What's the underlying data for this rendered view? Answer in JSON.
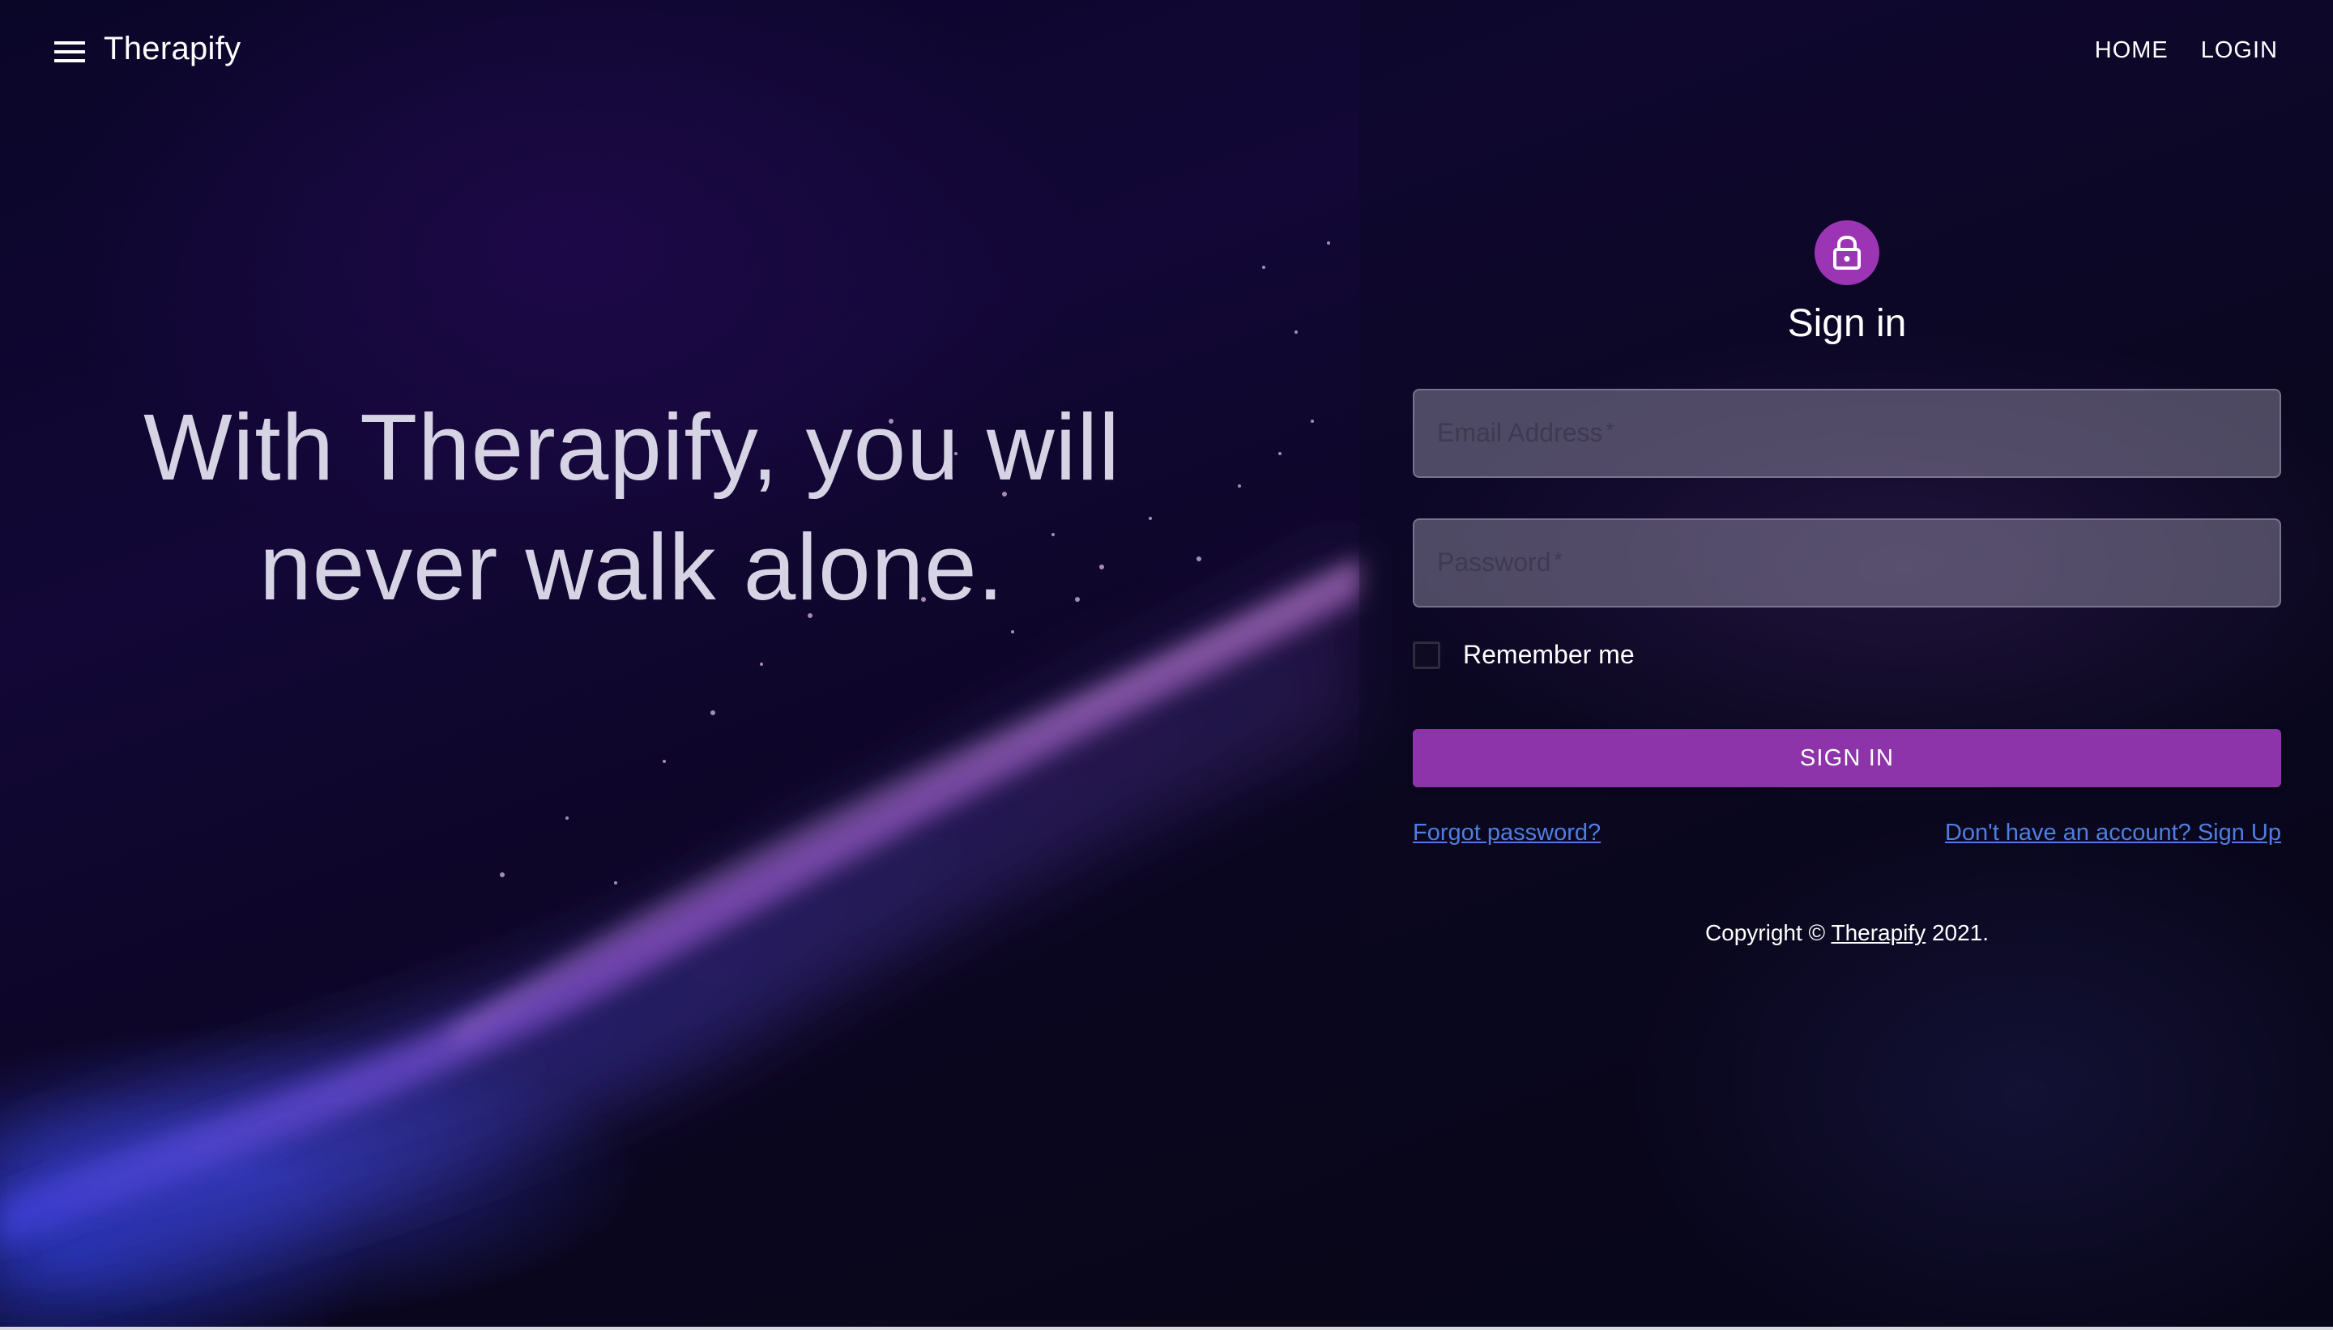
{
  "appbar": {
    "brand": "Therapify",
    "nav": {
      "home": "HOME",
      "login": "LOGIN"
    }
  },
  "hero": {
    "line1": "With Therapify, you will",
    "line2": "never walk alone."
  },
  "signin": {
    "title": "Sign in",
    "email_placeholder": "Email Address",
    "password_placeholder": "Password",
    "required_mark": "*",
    "remember_label": "Remember me",
    "remember_checked": false,
    "submit_label": "SIGN IN",
    "forgot_link": "Forgot password?",
    "signup_link": "Don't have an account? Sign Up"
  },
  "footer": {
    "copyright_prefix": "Copyright ©",
    "brand_link": "Therapify",
    "year_suffix": "2021."
  },
  "icons": {
    "menu": "menu-icon",
    "lock": "lock-icon"
  },
  "colors": {
    "accent": "#8e34aa",
    "avatar": "#9c35b3",
    "link": "#4f7ee0",
    "hero_text": "#d6d3e4"
  }
}
